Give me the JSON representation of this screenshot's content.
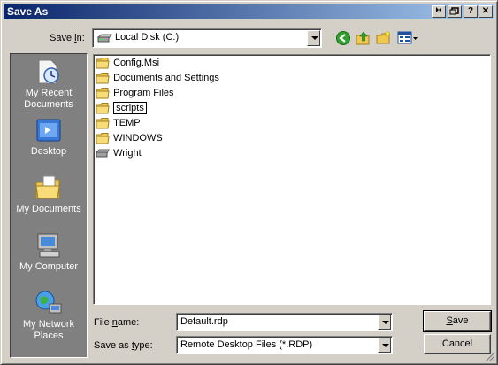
{
  "window": {
    "title": "Save As",
    "title_buttons": [
      "?",
      "✕"
    ]
  },
  "save_in": {
    "label_pre": "Save ",
    "label_key": "i",
    "label_post": "n:",
    "value": "Local Disk (C:)"
  },
  "places": [
    {
      "label": "My Recent Documents",
      "icon": "recent-documents-icon"
    },
    {
      "label": "Desktop",
      "icon": "desktop-icon"
    },
    {
      "label": "My Documents",
      "icon": "my-documents-icon"
    },
    {
      "label": "My Computer",
      "icon": "my-computer-icon"
    },
    {
      "label": "My Network Places",
      "icon": "network-places-icon"
    }
  ],
  "files": [
    {
      "name": "Config.Msi",
      "type": "folder"
    },
    {
      "name": "Documents and Settings",
      "type": "folder"
    },
    {
      "name": "Program Files",
      "type": "folder"
    },
    {
      "name": "scripts",
      "type": "folder",
      "renaming": true
    },
    {
      "name": "TEMP",
      "type": "folder"
    },
    {
      "name": "WINDOWS",
      "type": "folder"
    },
    {
      "name": "Wright",
      "type": "drive"
    }
  ],
  "file_name": {
    "label_pre": "File ",
    "label_key": "n",
    "label_post": "ame:",
    "value": "Default.rdp"
  },
  "save_type": {
    "label_pre": "Save as ",
    "label_key": "t",
    "label_post": "ype:",
    "value": "Remote Desktop Files (*.RDP)"
  },
  "buttons": {
    "save_key": "S",
    "save_rest": "ave",
    "cancel": "Cancel"
  },
  "colors": {
    "titlebar_start": "#0a246a",
    "titlebar_end": "#a6caf0",
    "dialog_bg": "#d4d0c8",
    "places_bg": "#808080"
  }
}
